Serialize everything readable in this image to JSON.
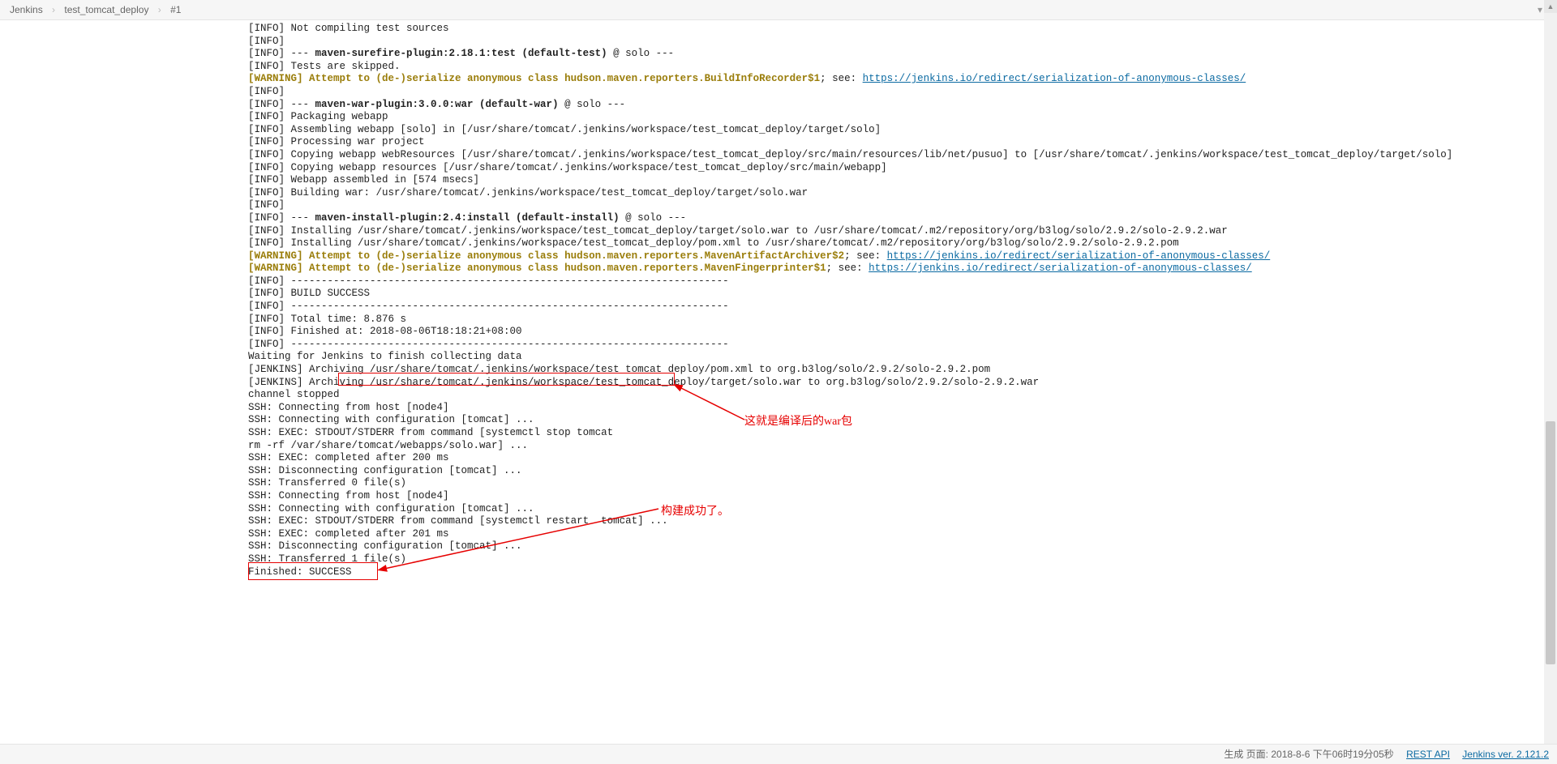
{
  "breadcrumb": {
    "root": "Jenkins",
    "job": "test_tomcat_deploy",
    "build": "#1"
  },
  "annotations": {
    "war_note": "这就是编译后的war包",
    "success_note": "构建成功了。"
  },
  "footer": {
    "generated": "生成 页面: 2018-8-6 下午06时19分05秒",
    "rest_api": "REST API",
    "version": "Jenkins ver. 2.121.2"
  },
  "console": {
    "lines": [
      {
        "p": "[INFO] ",
        "t": "Not compiling test sources"
      },
      {
        "p": "[INFO] ",
        "t": ""
      },
      {
        "p": "[INFO] ",
        "t": "--- ",
        "b": "maven-surefire-plugin:2.18.1:test (default-test)",
        "rest": " @ solo ---"
      },
      {
        "p": "[INFO] ",
        "t": "Tests are skipped."
      },
      {
        "warn": true,
        "p": "[WARNING] ",
        "t": "Attempt to (de-)serialize anonymous class hudson.maven.reporters.BuildInfoRecorder$1",
        "see": "; see: ",
        "link": "https://jenkins.io/redirect/serialization-of-anonymous-classes/"
      },
      {
        "p": "[INFO] ",
        "t": ""
      },
      {
        "p": "[INFO] ",
        "t": "--- ",
        "b": "maven-war-plugin:3.0.0:war (default-war)",
        "rest": " @ solo ---"
      },
      {
        "p": "[INFO] ",
        "t": "Packaging webapp"
      },
      {
        "p": "[INFO] ",
        "t": "Assembling webapp [solo] in [/usr/share/tomcat/.jenkins/workspace/test_tomcat_deploy/target/solo]"
      },
      {
        "p": "[INFO] ",
        "t": "Processing war project"
      },
      {
        "p": "[INFO] ",
        "t": "Copying webapp webResources [/usr/share/tomcat/.jenkins/workspace/test_tomcat_deploy/src/main/resources/lib/net/pusuo] to [/usr/share/tomcat/.jenkins/workspace/test_tomcat_deploy/target/solo]"
      },
      {
        "p": "[INFO] ",
        "t": "Copying webapp resources [/usr/share/tomcat/.jenkins/workspace/test_tomcat_deploy/src/main/webapp]"
      },
      {
        "p": "[INFO] ",
        "t": "Webapp assembled in [574 msecs]"
      },
      {
        "p": "[INFO] ",
        "t": "Building war: /usr/share/tomcat/.jenkins/workspace/test_tomcat_deploy/target/solo.war"
      },
      {
        "p": "[INFO] ",
        "t": ""
      },
      {
        "p": "[INFO] ",
        "t": "--- ",
        "b": "maven-install-plugin:2.4:install (default-install)",
        "rest": " @ solo ---"
      },
      {
        "p": "[INFO] ",
        "t": "Installing /usr/share/tomcat/.jenkins/workspace/test_tomcat_deploy/target/solo.war to /usr/share/tomcat/.m2/repository/org/b3log/solo/2.9.2/solo-2.9.2.war"
      },
      {
        "p": "[INFO] ",
        "t": "Installing /usr/share/tomcat/.jenkins/workspace/test_tomcat_deploy/pom.xml to /usr/share/tomcat/.m2/repository/org/b3log/solo/2.9.2/solo-2.9.2.pom"
      },
      {
        "warn": true,
        "p": "[WARNING] ",
        "t": "Attempt to (de-)serialize anonymous class hudson.maven.reporters.MavenArtifactArchiver$2",
        "see": "; see: ",
        "link": "https://jenkins.io/redirect/serialization-of-anonymous-classes/"
      },
      {
        "warn": true,
        "p": "[WARNING] ",
        "t": "Attempt to (de-)serialize anonymous class hudson.maven.reporters.MavenFingerprinter$1",
        "see": "; see: ",
        "link": "https://jenkins.io/redirect/serialization-of-anonymous-classes/"
      },
      {
        "p": "[INFO] ",
        "t": "------------------------------------------------------------------------"
      },
      {
        "p": "[INFO] ",
        "t": "BUILD SUCCESS"
      },
      {
        "p": "[INFO] ",
        "t": "------------------------------------------------------------------------"
      },
      {
        "p": "[INFO] ",
        "t": "Total time: 8.876 s"
      },
      {
        "p": "[INFO] ",
        "t": "Finished at: 2018-08-06T18:18:21+08:00"
      },
      {
        "p": "[INFO] ",
        "t": "------------------------------------------------------------------------"
      },
      {
        "t": "Waiting for Jenkins to finish collecting data"
      },
      {
        "p": "[JENKINS] ",
        "t": "Archiving /usr/share/tomcat/.jenkins/workspace/test_tomcat_deploy/pom.xml to org.b3log/solo/2.9.2/solo-2.9.2.pom"
      },
      {
        "p": "[JENKINS] ",
        "t": "Archiving /usr/share/tomcat/.jenkins/workspace/test_tomcat_deploy/target/solo.war to org.b3log/solo/2.9.2/solo-2.9.2.war"
      },
      {
        "t": "channel stopped"
      },
      {
        "t": "SSH: Connecting from host [node4]"
      },
      {
        "t": "SSH: Connecting with configuration [tomcat] ..."
      },
      {
        "t": "SSH: EXEC: STDOUT/STDERR from command [systemctl stop tomcat"
      },
      {
        "t": "rm -rf /var/share/tomcat/webapps/solo.war] ..."
      },
      {
        "t": "SSH: EXEC: completed after 200 ms"
      },
      {
        "t": "SSH: Disconnecting configuration [tomcat] ..."
      },
      {
        "t": "SSH: Transferred 0 file(s)"
      },
      {
        "t": "SSH: Connecting from host [node4]"
      },
      {
        "t": "SSH: Connecting with configuration [tomcat] ..."
      },
      {
        "t": "SSH: EXEC: STDOUT/STDERR from command [systemctl restart  tomcat] ..."
      },
      {
        "t": "SSH: EXEC: completed after 201 ms"
      },
      {
        "t": "SSH: Disconnecting configuration [tomcat] ..."
      },
      {
        "t": "SSH: Transferred 1 file(s)"
      },
      {
        "t": "Finished: SUCCESS"
      }
    ]
  }
}
